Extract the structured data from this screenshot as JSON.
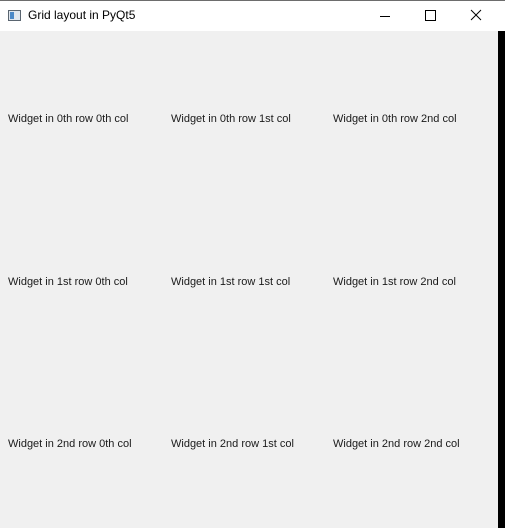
{
  "window": {
    "title": "Grid layout in PyQt5",
    "controls": {
      "minimize": "minimize-icon",
      "maximize": "maximize-icon",
      "close": "close-icon"
    }
  },
  "grid": {
    "rows": [
      [
        "Widget in 0th row 0th col",
        "Widget in 0th row 1st col",
        "Widget in 0th row 2nd col"
      ],
      [
        "Widget in 1st row 0th col",
        "Widget in 1st row 1st col",
        "Widget in 1st row 2nd col"
      ],
      [
        "Widget in 2nd row 0th col",
        "Widget in 2nd row 1st col",
        "Widget in 2nd row 2nd col"
      ]
    ]
  }
}
